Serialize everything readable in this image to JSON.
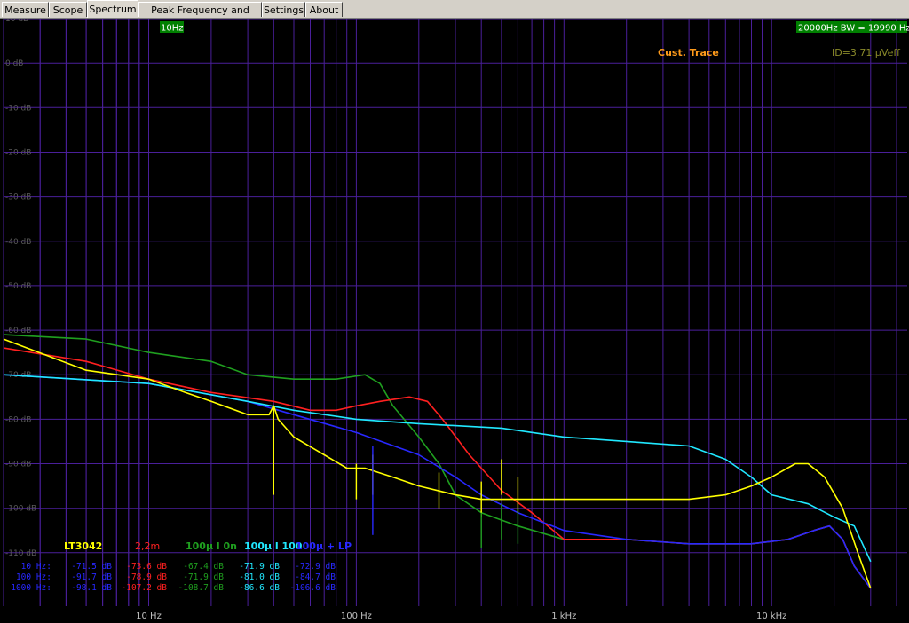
{
  "tabs": [
    "Measure",
    "Scope",
    "Spectrum",
    "Peak Frequency and Level",
    "Settings",
    "About"
  ],
  "active_tab": 2,
  "header": {
    "start_freq": "10Hz",
    "bw": "20000Hz BW = 19990 Hz"
  },
  "annotations": {
    "cust_trace": "Cust. Trace",
    "id_readout": "ID=3.71 µVeff"
  },
  "colors": {
    "grid": "#4a1f9a",
    "LT3042": "#ffff00",
    "2,2m": "#ff2020",
    "100µ l 0n": "#1f9f1f",
    "100µ l 100": "#20e8ff",
    "100µ + LP": "#2828ff",
    "header_bg": "#008000",
    "cust_trace": "#ff9b1a",
    "id_readout": "#8a8a2a"
  },
  "chart_data": {
    "type": "line",
    "xscale": "log",
    "xlim": [
      2,
      45000
    ],
    "ylim": [
      -122,
      10
    ],
    "x_ticks": [
      "10 Hz",
      "100 Hz",
      "1 kHz",
      "10 kHz"
    ],
    "y_ticks": [
      "10 dB",
      "0 dB",
      "-10 dB",
      "-20 dB",
      "-30 dB",
      "-40 dB",
      "-50 dB",
      "-60 dB",
      "-70 dB",
      "-80 dB",
      "-90 dB",
      "-100 dB",
      "-110 dB"
    ],
    "series": [
      {
        "name": "LT3042",
        "points": [
          [
            2,
            -62
          ],
          [
            5,
            -69
          ],
          [
            10,
            -71
          ],
          [
            15,
            -74
          ],
          [
            20,
            -76
          ],
          [
            30,
            -79
          ],
          [
            38,
            -79
          ],
          [
            40,
            -77
          ],
          [
            42,
            -80
          ],
          [
            50,
            -84
          ],
          [
            70,
            -88
          ],
          [
            90,
            -91
          ],
          [
            110,
            -91
          ],
          [
            150,
            -93
          ],
          [
            200,
            -95
          ],
          [
            300,
            -97
          ],
          [
            400,
            -98
          ],
          [
            600,
            -98
          ],
          [
            1000,
            -98
          ],
          [
            2000,
            -98
          ],
          [
            4000,
            -98
          ],
          [
            6000,
            -97
          ],
          [
            8000,
            -95
          ],
          [
            10000,
            -93
          ],
          [
            13000,
            -90
          ],
          [
            15000,
            -90
          ],
          [
            18000,
            -93
          ],
          [
            22000,
            -100
          ],
          [
            26000,
            -110
          ],
          [
            30000,
            -118
          ]
        ]
      },
      {
        "name": "2,2m",
        "points": [
          [
            2,
            -64
          ],
          [
            5,
            -67
          ],
          [
            10,
            -71
          ],
          [
            20,
            -74
          ],
          [
            40,
            -76
          ],
          [
            60,
            -78
          ],
          [
            80,
            -78
          ],
          [
            100,
            -77
          ],
          [
            130,
            -76
          ],
          [
            180,
            -75
          ],
          [
            220,
            -76
          ],
          [
            260,
            -80
          ],
          [
            350,
            -88
          ],
          [
            500,
            -96
          ],
          [
            700,
            -101
          ],
          [
            1000,
            -107
          ],
          [
            2000,
            -107
          ],
          [
            4000,
            -108
          ],
          [
            8000,
            -108
          ],
          [
            12000,
            -107
          ],
          [
            16000,
            -105
          ],
          [
            19000,
            -104
          ],
          [
            22000,
            -107
          ],
          [
            25000,
            -113
          ],
          [
            30000,
            -118
          ]
        ]
      },
      {
        "name": "100µ l 0n",
        "points": [
          [
            2,
            -61
          ],
          [
            5,
            -62
          ],
          [
            10,
            -65
          ],
          [
            20,
            -67
          ],
          [
            30,
            -70
          ],
          [
            50,
            -71
          ],
          [
            80,
            -71
          ],
          [
            110,
            -70
          ],
          [
            130,
            -72
          ],
          [
            150,
            -77
          ],
          [
            200,
            -84
          ],
          [
            250,
            -90
          ],
          [
            300,
            -97
          ],
          [
            400,
            -101
          ],
          [
            600,
            -104
          ],
          [
            1000,
            -107
          ],
          [
            2000,
            -107
          ],
          [
            4000,
            -108
          ],
          [
            8000,
            -108
          ],
          [
            12000,
            -107
          ],
          [
            16000,
            -105
          ],
          [
            19000,
            -104
          ],
          [
            22000,
            -107
          ],
          [
            25000,
            -113
          ],
          [
            30000,
            -118
          ]
        ]
      },
      {
        "name": "100µ l 100",
        "points": [
          [
            2,
            -70
          ],
          [
            10,
            -72
          ],
          [
            30,
            -76
          ],
          [
            50,
            -78
          ],
          [
            100,
            -80
          ],
          [
            200,
            -81
          ],
          [
            500,
            -82
          ],
          [
            1000,
            -84
          ],
          [
            2000,
            -85
          ],
          [
            4000,
            -86
          ],
          [
            6000,
            -89
          ],
          [
            8000,
            -93
          ],
          [
            10000,
            -97
          ],
          [
            15000,
            -99
          ],
          [
            20000,
            -102
          ],
          [
            25000,
            -104
          ],
          [
            30000,
            -112
          ]
        ]
      },
      {
        "name": "100µ + LP",
        "points": [
          [
            2,
            -70
          ],
          [
            10,
            -72
          ],
          [
            30,
            -76
          ],
          [
            50,
            -79
          ],
          [
            100,
            -83
          ],
          [
            200,
            -88
          ],
          [
            300,
            -93
          ],
          [
            400,
            -97
          ],
          [
            600,
            -101
          ],
          [
            1000,
            -105
          ],
          [
            2000,
            -107
          ],
          [
            4000,
            -108
          ],
          [
            8000,
            -108
          ],
          [
            12000,
            -107
          ],
          [
            16000,
            -105
          ],
          [
            19000,
            -104
          ],
          [
            22000,
            -107
          ],
          [
            25000,
            -113
          ],
          [
            30000,
            -118
          ]
        ]
      }
    ],
    "spurs": [
      {
        "name": "LT3042",
        "points": [
          [
            40,
            -77
          ],
          [
            100,
            -90
          ],
          [
            120,
            -88
          ],
          [
            250,
            -92
          ],
          [
            400,
            -94
          ],
          [
            500,
            -89
          ],
          [
            600,
            -93
          ]
        ]
      },
      {
        "name": "100µ l 0n",
        "points": [
          [
            400,
            -101
          ],
          [
            500,
            -99
          ],
          [
            600,
            -100
          ]
        ]
      },
      {
        "name": "100µ + LP",
        "points": [
          [
            120,
            -86
          ]
        ]
      }
    ],
    "legend": [
      "LT3042",
      "2,2m",
      "100µ l 0n",
      "100µ l 100",
      "100µ + LP"
    ],
    "table": {
      "row_labels": [
        "10 Hz:",
        "100 Hz:",
        "1000 Hz:"
      ],
      "columns": [
        {
          "name": "100µ + LP",
          "values": [
            "-71.5 dB",
            "-91.7 dB",
            "-98.1 dB"
          ]
        },
        {
          "name": "2,2m",
          "values": [
            "-73.6 dB",
            "-78.9 dB",
            "-107.2 dB"
          ]
        },
        {
          "name": "100µ l 0n",
          "values": [
            "-67.4 dB",
            "-71.9 dB",
            "-108.7 dB"
          ]
        },
        {
          "name": "100µ l 100",
          "values": [
            "-71.9 dB",
            "-81.0 dB",
            "-86.6 dB"
          ]
        },
        {
          "name": "100µ + LP",
          "values": [
            "-72.9 dB",
            "-84.7 dB",
            "-106.6 dB"
          ]
        }
      ]
    }
  }
}
